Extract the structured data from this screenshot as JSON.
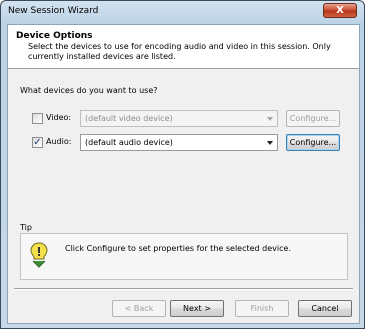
{
  "window": {
    "title": "New Session Wizard",
    "close_symbol": "X"
  },
  "header": {
    "title": "Device Options",
    "description": "Select the devices to use for encoding audio and video in this session. Only currently installed devices are listed."
  },
  "devices": {
    "question": "What devices do you want to use?",
    "video": {
      "label": "Video:",
      "checked": false,
      "select_value": "(default video device)",
      "configure_label": "Configure...",
      "enabled": false
    },
    "audio": {
      "label": "Audio:",
      "checked": true,
      "check_mark": "✓",
      "select_value": "(default audio device)",
      "configure_label": "Configure...",
      "enabled": true
    }
  },
  "tip": {
    "label": "Tip",
    "text": "Click Configure to set properties for the selected device.",
    "icon": "lightbulb-icon"
  },
  "footer": {
    "back_label": "< Back",
    "next_label": "Next >",
    "finish_label": "Finish",
    "cancel_label": "Cancel"
  }
}
